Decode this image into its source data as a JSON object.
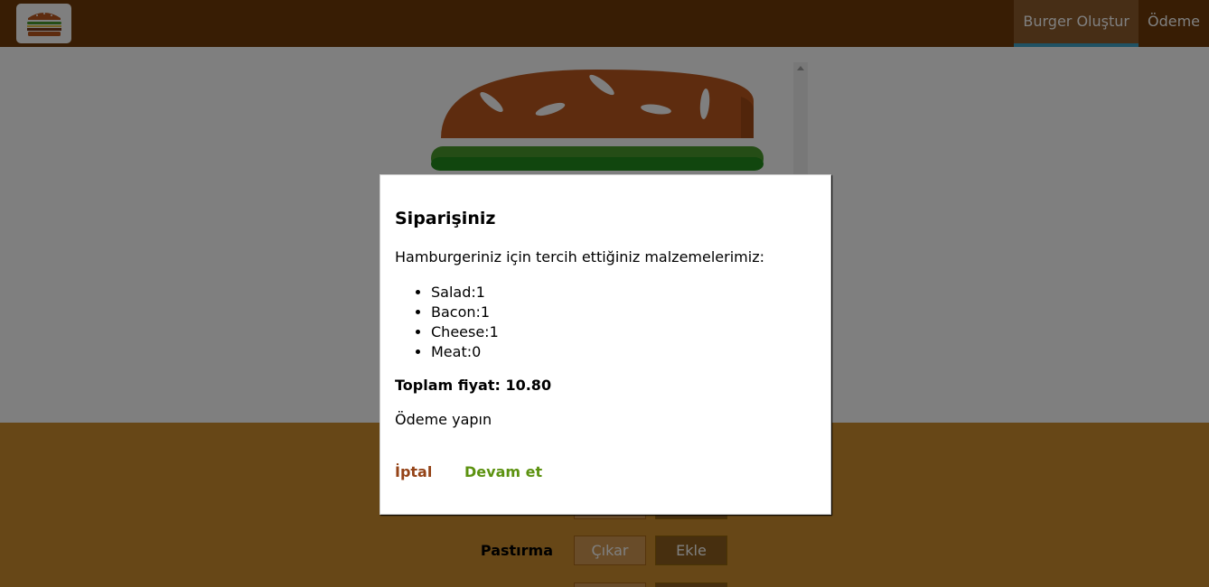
{
  "header": {
    "logo_icon": "burger-logo-icon",
    "nav": [
      {
        "label": "Burger Oluştur",
        "active": true
      },
      {
        "label": "Ödeme",
        "active": false
      }
    ]
  },
  "controls": [
    {
      "label": "Pastırma",
      "less_label": "Çıkar",
      "more_label": "Ekle"
    }
  ],
  "modal": {
    "title": "Siparişiniz",
    "intro": "Hamburgeriniz için tercih ettiğiniz malzemelerimiz:",
    "ingredients": [
      "Salad:1",
      "Bacon:1",
      "Cheese:1",
      "Meat:0"
    ],
    "total": "Toplam fiyat: 10.80",
    "cta": "Ödeme yapın",
    "cancel_label": "İptal",
    "continue_label": "Devam et"
  },
  "colors": {
    "toolbar": "#703B09",
    "controls_bg": "#CF8F2E",
    "cancel": "#944317",
    "continue": "#5C9210",
    "bread": "#BC581E",
    "salad": "#228C1D"
  }
}
